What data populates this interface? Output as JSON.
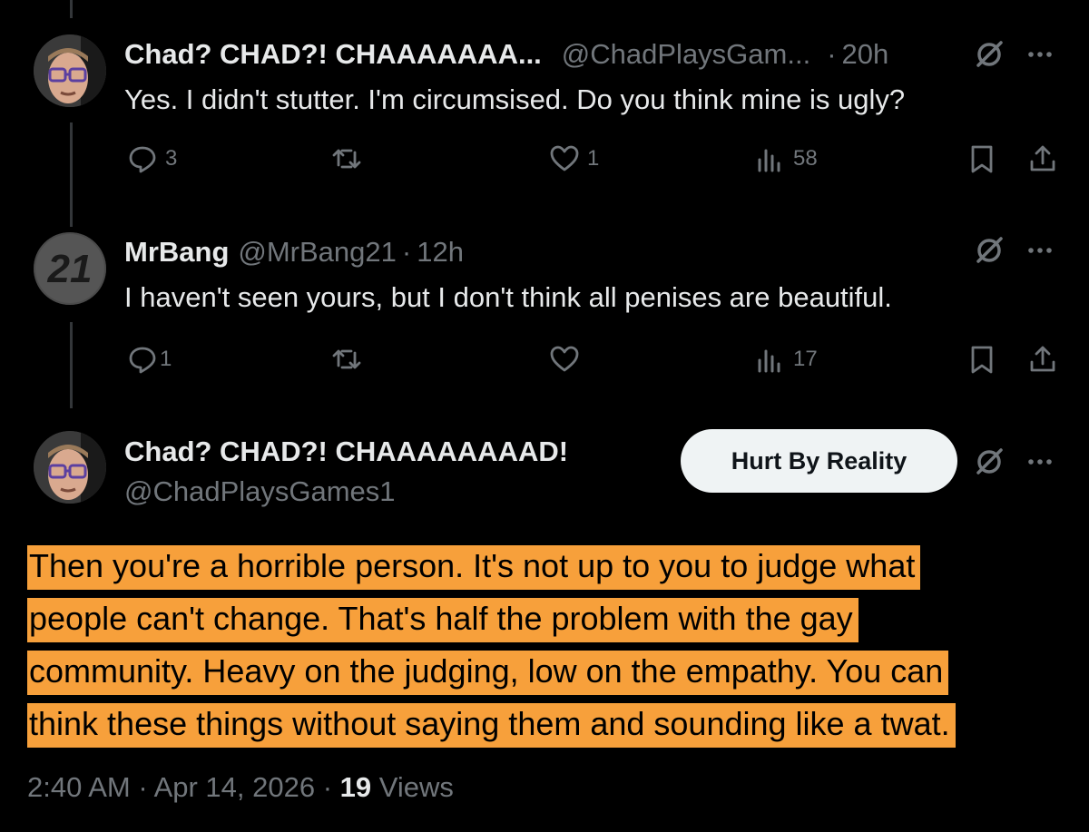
{
  "tweets": [
    {
      "name": "Chad? CHAD?! CHAAAAAAA...",
      "handle": "@ChadPlaysGam...",
      "time": "20h",
      "text": "Yes. I didn't stutter. I'm circumsised. Do you think mine is ugly?",
      "replies": "3",
      "retweets": "",
      "likes": "1",
      "views": "58",
      "avatar": "avatar-chad"
    },
    {
      "name": "MrBang",
      "handle": "@MrBang21",
      "time": "12h",
      "text": "I haven't seen yours, but I don't think all penises are beautiful.",
      "replies": "1",
      "retweets": "",
      "likes": "",
      "views": "17",
      "avatar": "avatar-21-logo"
    }
  ],
  "main_tweet": {
    "name": "Chad? CHAD?! CHAAAAAAAAD!",
    "handle": "@ChadPlaysGames1",
    "follow_button": "Hurt By Reality",
    "text_lines": [
      "Then you're a horrible person. It's not up to you to judge what",
      "people can't change. That's half the problem with the gay",
      "community. Heavy on the judging, low on the empathy. You can",
      "think these things without saying them and sounding like a twat."
    ],
    "timestamp": "2:40 AM · Apr 14, 2026 · ",
    "views_count": "19",
    "views_label": " Views",
    "highlight_color": "#f7a03b"
  },
  "icons": {
    "reply": "reply-icon",
    "retweet": "retweet-icon",
    "like": "heart-icon",
    "views": "views-icon",
    "bookmark": "bookmark-icon",
    "share": "share-icon",
    "grok": "grok-icon",
    "more": "more-icon"
  }
}
